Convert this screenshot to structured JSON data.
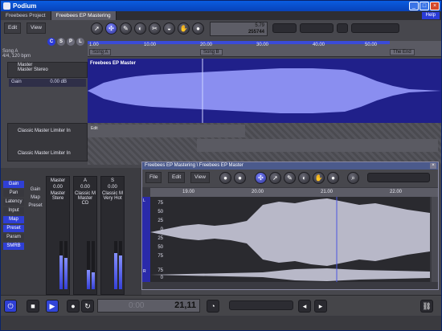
{
  "window": {
    "title": "Podium"
  },
  "tabs": [
    {
      "label": "Freebees Project",
      "active": false
    },
    {
      "label": "Freebees EP Mastering",
      "active": true
    }
  ],
  "help_label": "Help",
  "toolbar": {
    "edit_label": "Edit",
    "view_label": "View",
    "position_top": "5.79",
    "position_bottom": "255744"
  },
  "csp_buttons": [
    "C",
    "S",
    "P",
    "L"
  ],
  "song": {
    "name": "Song A",
    "tempo": "4/4, 120 bpm"
  },
  "ruler": {
    "ticks": [
      "1.00",
      "10.00",
      "20.00",
      "30.00",
      "40.00",
      "50.00"
    ],
    "markers": [
      "Song A",
      "Song B",
      "The End"
    ]
  },
  "track_master": {
    "name": "Master",
    "stereo": "Master Stereo",
    "gain_label": "Gain",
    "gain_value": "0.00 dB"
  },
  "lane_master_title": "Freebees EP Master",
  "limiter_label_a": "Classic Master Limiter In",
  "limiter_label_b": "Classic Master Limiter In",
  "edit_label": "Edit",
  "mixer": {
    "side_buttons": [
      "Gain",
      "Pan",
      "Latency",
      "Input",
      "Map",
      "Preset",
      "Param",
      "SMRB"
    ],
    "labels": [
      "Gain",
      "Map",
      "Preset"
    ],
    "strips": [
      {
        "name": "Master",
        "value": "0.00",
        "desc": "Master Stere"
      },
      {
        "name": "A",
        "value": "0.00",
        "desc": "Classic M Master CD"
      },
      {
        "name": "S",
        "value": "0.00",
        "desc": "Classic M Very Hot"
      }
    ]
  },
  "mastering": {
    "title": "Freebees EP Mastering \\ Freebees EP Master",
    "file_label": "File",
    "edit_label": "Edit",
    "view_label": "View",
    "ruler_ticks": [
      "19.00",
      "20.00",
      "21.00",
      "22.00"
    ],
    "y_axis_L": [
      "75",
      "50",
      "25",
      "0",
      "25",
      "50",
      "75"
    ],
    "y_axis_R": [
      "75",
      "0"
    ],
    "channel_L": "L",
    "channel_R": "R"
  },
  "transport": {
    "display_small": "0:00",
    "display_big": "21,11"
  }
}
